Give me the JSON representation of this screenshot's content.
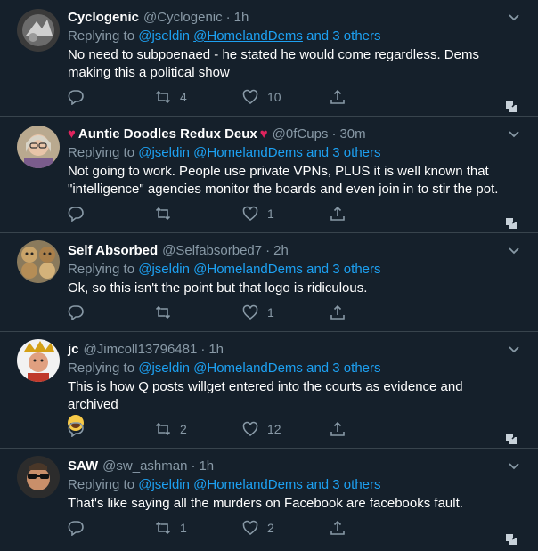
{
  "tweets": [
    {
      "name": "Cyclogenic",
      "handle": "@Cyclogenic",
      "time": "1h",
      "replying_prefix": "Replying to ",
      "reply_user1": "@jseldin",
      "reply_user2": "@HomelandDems",
      "reply_rest": " and 3 others",
      "text": "No need to subpoenaed - he stated he would come regardless. Dems making this a political show",
      "retweets": "4",
      "likes": "10"
    },
    {
      "name": "Auntie Doodles Redux Deux",
      "name_prefix_emoji": "♥",
      "name_suffix_emoji": "♥",
      "handle": "@0fCups",
      "time": "30m",
      "replying_prefix": "Replying to ",
      "reply_user1": "@jseldin",
      "reply_user2": "@HomelandDems",
      "reply_rest": " and 3 others",
      "text": "Not going to work. People use private VPNs, PLUS it is well known that \"intelligence\" agencies monitor the boards and even join in to stir the pot.",
      "retweets": "",
      "likes": "1"
    },
    {
      "name": "Self Absorbed",
      "handle": "@Selfabsorbed7",
      "time": "2h",
      "replying_prefix": "Replying to ",
      "reply_user1": "@jseldin",
      "reply_user2": "@HomelandDems",
      "reply_rest": " and 3 others",
      "text": "Ok, so this isn't the point but that logo is ridiculous.",
      "retweets": "",
      "likes": "1"
    },
    {
      "name": "jc",
      "handle": "@Jimcoll13796481",
      "time": "1h",
      "replying_prefix": "Replying to ",
      "reply_user1": "@jseldin",
      "reply_user2": "@HomelandDems",
      "reply_rest": " and 3 others",
      "text": "This is how Q posts willget entered into the courts as evidence and archived",
      "retweets": "2",
      "likes": "12"
    },
    {
      "name": "SAW",
      "handle": "@sw_ashman",
      "time": "1h",
      "replying_prefix": "Replying to ",
      "reply_user1": "@jseldin",
      "reply_user2": "@HomelandDems",
      "reply_rest": " and 3 others",
      "text": "That's like saying all the murders on Facebook are facebooks fault.",
      "retweets": "1",
      "likes": "2"
    }
  ],
  "dot": "·",
  "colors": {
    "background": "#15202b",
    "secondary": "#8899a6",
    "link": "#1da1f2",
    "heart": "#e0245e",
    "divider": "#38444d"
  },
  "icons": [
    "reply-icon",
    "retweet-icon",
    "like-icon",
    "share-icon",
    "chevron-down-icon",
    "extension-icon"
  ]
}
